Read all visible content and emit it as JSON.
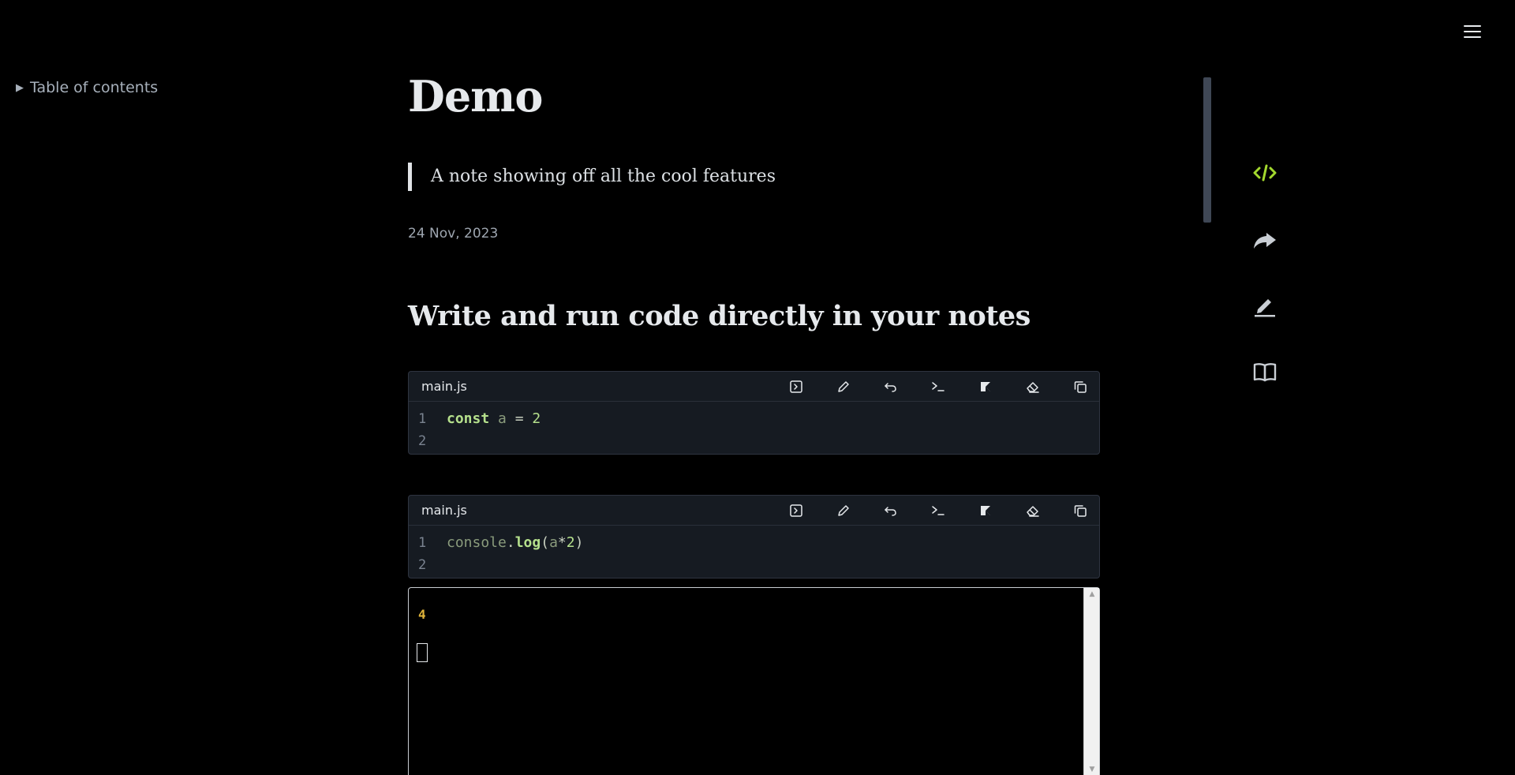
{
  "toc": {
    "label": "Table of contents"
  },
  "article": {
    "title": "Demo",
    "description": "A note showing off all the cool features",
    "date": "24 Nov, 2023",
    "section_heading": "Write and run code directly in your notes"
  },
  "code_blocks": [
    {
      "filename": "main.js",
      "lines": [
        {
          "number": "1",
          "tokens": [
            [
              "kw",
              "const"
            ],
            [
              "plain",
              " "
            ],
            [
              "var",
              "a"
            ],
            [
              "plain",
              " = "
            ],
            [
              "num",
              "2"
            ]
          ]
        },
        {
          "number": "2",
          "tokens": []
        }
      ]
    },
    {
      "filename": "main.js",
      "lines": [
        {
          "number": "1",
          "tokens": [
            [
              "var",
              "console"
            ],
            [
              "plain",
              "."
            ],
            [
              "fn",
              "log"
            ],
            [
              "plain",
              "("
            ],
            [
              "var",
              "a"
            ],
            [
              "plain",
              "*"
            ],
            [
              "num",
              "2"
            ],
            [
              "plain",
              ")"
            ]
          ]
        },
        {
          "number": "2",
          "tokens": []
        }
      ]
    }
  ],
  "code_tools": [
    "run-icon",
    "edit-icon",
    "undo-icon",
    "terminal-icon",
    "kotlin-icon",
    "eraser-icon",
    "copy-icon"
  ],
  "terminal": {
    "output": "4"
  },
  "rail": [
    "code-icon",
    "share-icon",
    "pencil-icon",
    "book-icon"
  ],
  "colors": {
    "accent": "#a3d82e",
    "background": "#000000",
    "code_bg": "#161b22",
    "output": "#e0b43a"
  }
}
